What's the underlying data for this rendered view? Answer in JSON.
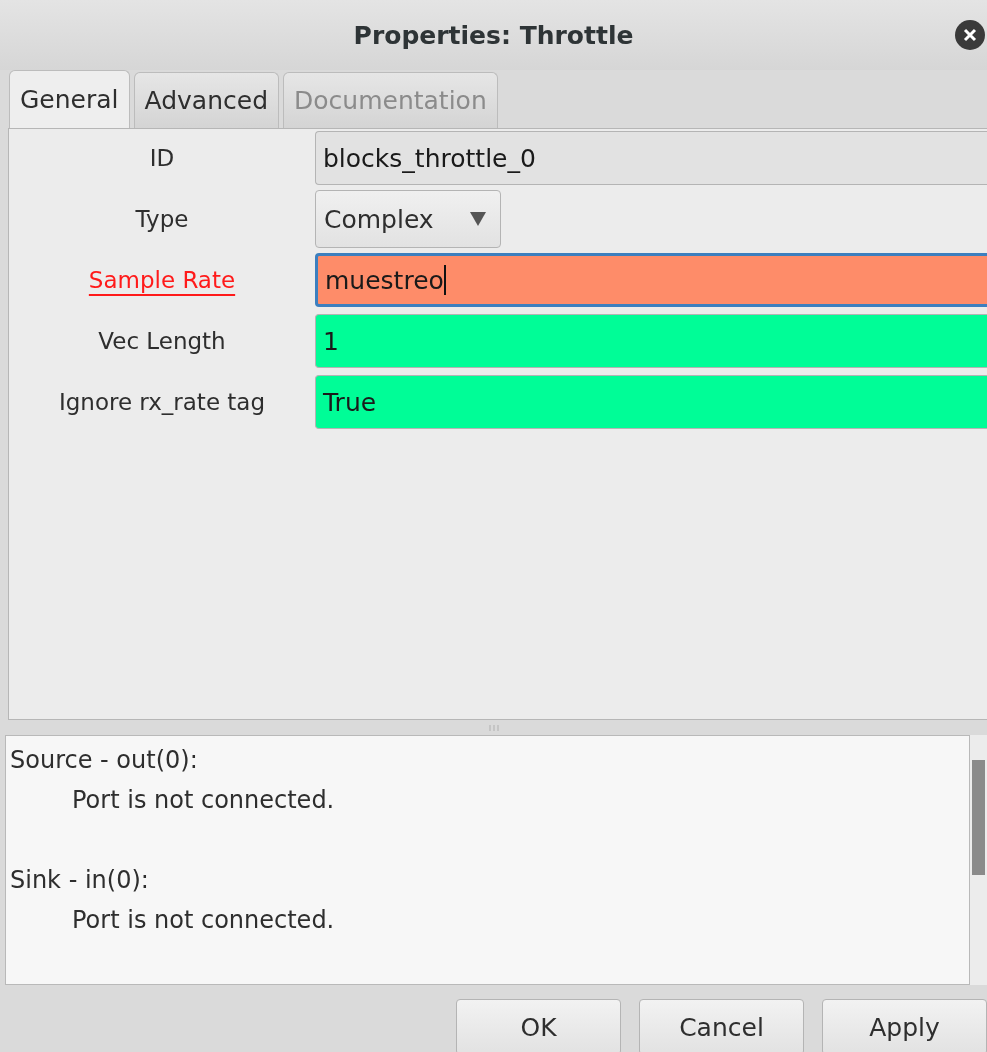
{
  "window": {
    "title": "Properties: Throttle"
  },
  "tabs": [
    {
      "label": "General",
      "selected": true,
      "disabled": false
    },
    {
      "label": "Advanced",
      "selected": false,
      "disabled": false
    },
    {
      "label": "Documentation",
      "selected": false,
      "disabled": true
    }
  ],
  "params": [
    {
      "label": "ID",
      "kind": "readonly",
      "value": "blocks_throttle_0"
    },
    {
      "label": "Type",
      "kind": "dropdown",
      "value": "Complex"
    },
    {
      "label": "Sample Rate",
      "kind": "entry",
      "value": "muestreo",
      "invalid": true,
      "focused": true
    },
    {
      "label": "Vec Length",
      "kind": "entry",
      "value": "1",
      "invalid": false,
      "focused": false
    },
    {
      "label": "Ignore rx_rate tag",
      "kind": "entry",
      "value": "True",
      "invalid": false,
      "focused": false
    }
  ],
  "messages": [
    {
      "heading": "Source - out(0):",
      "detail": "Port is not connected."
    },
    {
      "heading": "Sink - in(0):",
      "detail": "Port is not connected."
    }
  ],
  "buttons": [
    "OK",
    "Cancel",
    "Apply"
  ]
}
